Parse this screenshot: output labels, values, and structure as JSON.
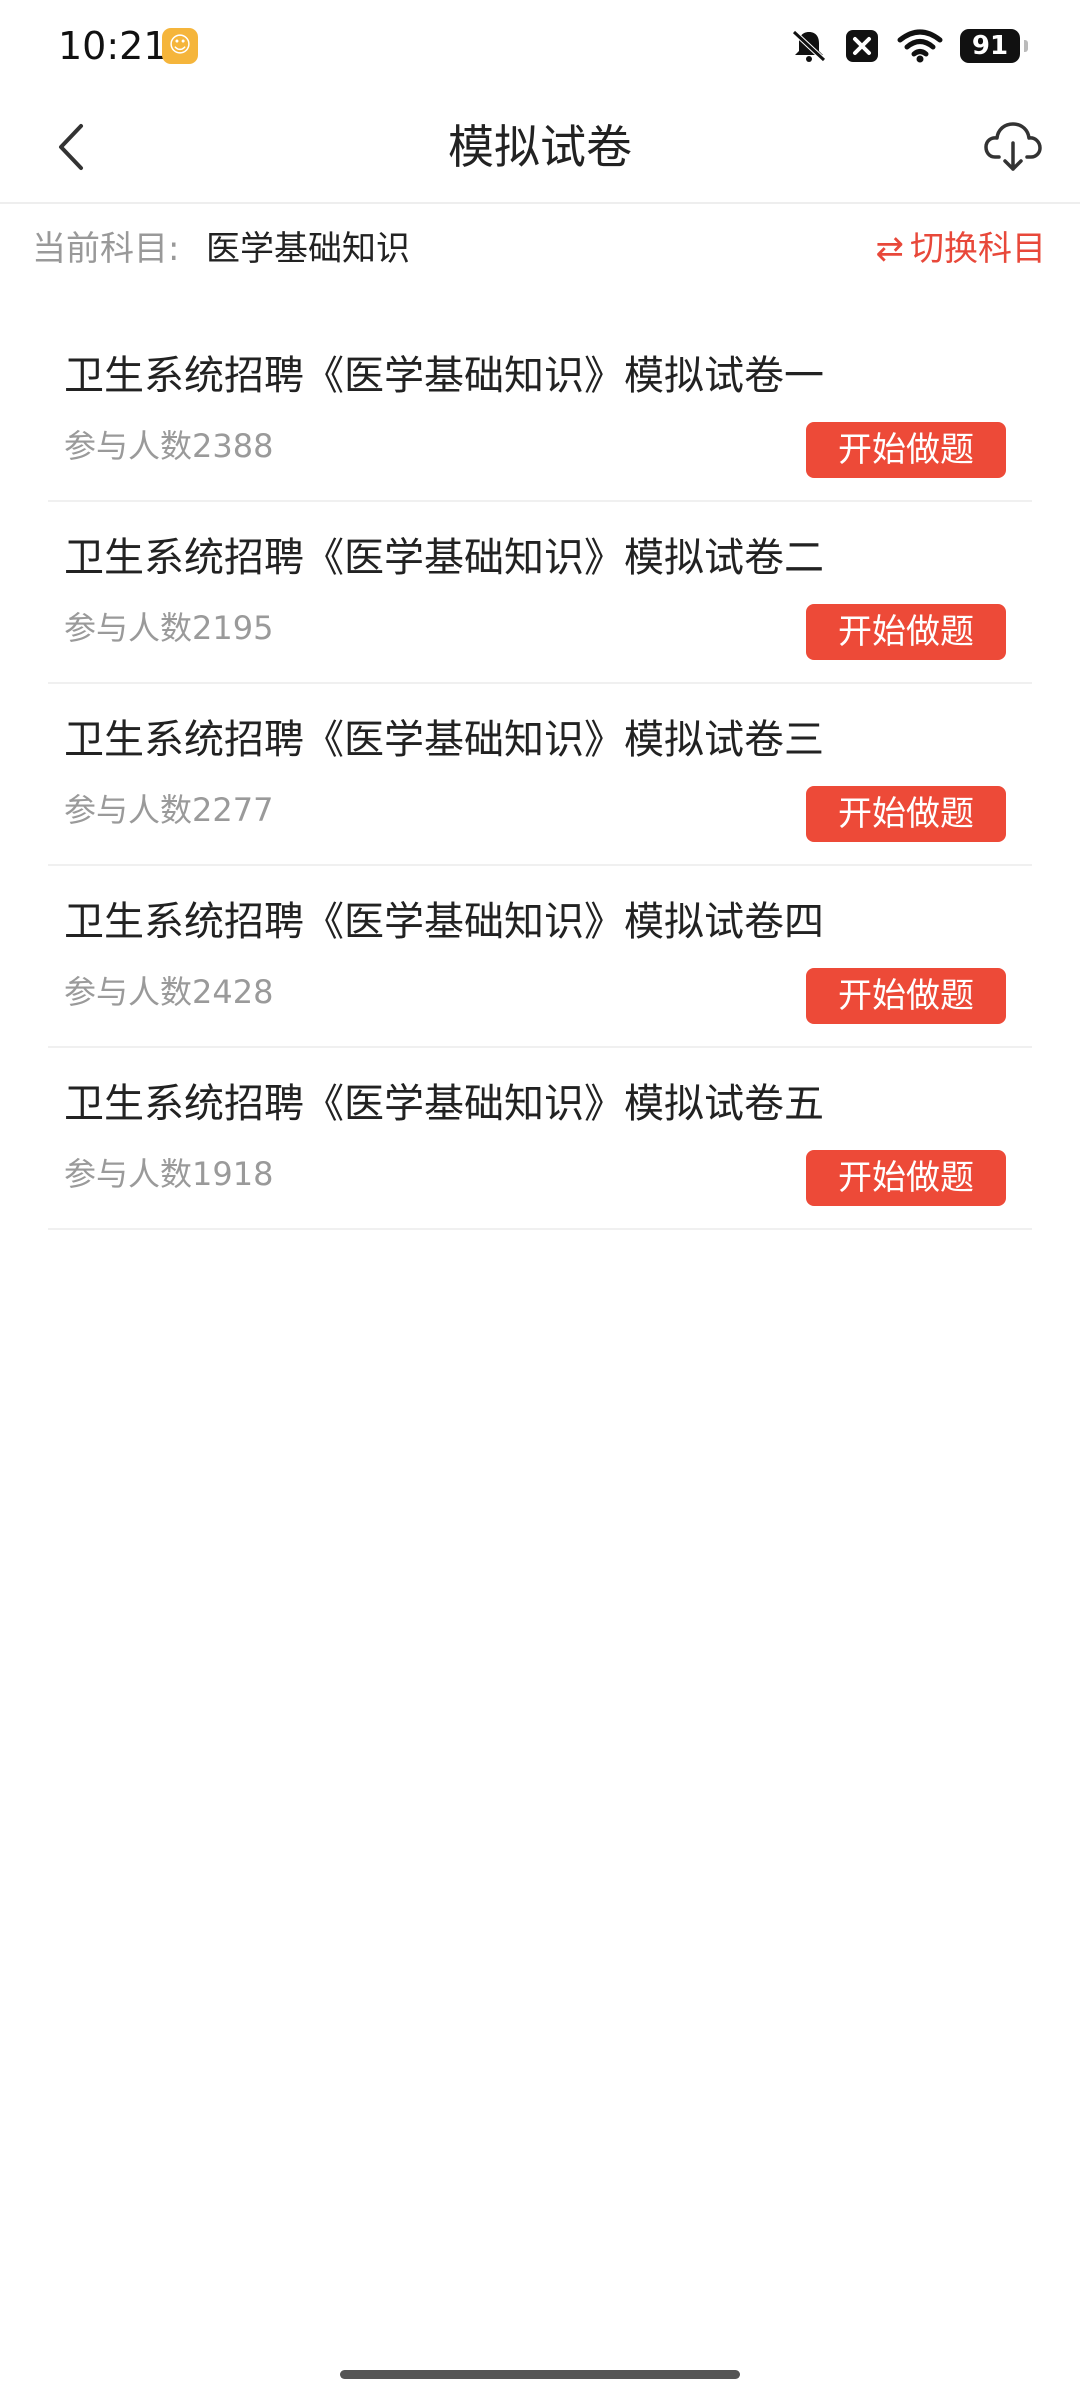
{
  "status_bar": {
    "time": "10:21",
    "app_icon": "app-notification-icon",
    "battery": "91",
    "icons": [
      "mute-icon",
      "close-notification-icon",
      "wifi-icon",
      "battery-icon"
    ]
  },
  "header": {
    "title": "模拟试卷",
    "back_icon": "chevron-left-icon",
    "download_icon": "cloud-download-icon"
  },
  "subject": {
    "label": "当前科目:",
    "value": "医学基础知识",
    "switch_label": "切换科目",
    "switch_icon": "swap-arrows-icon",
    "accent_color": "#e8483a"
  },
  "papers": [
    {
      "title": "卫生系统招聘《医学基础知识》模拟试卷一",
      "count": "参与人数2388",
      "button": "开始做题"
    },
    {
      "title": "卫生系统招聘《医学基础知识》模拟试卷二",
      "count": "参与人数2195",
      "button": "开始做题"
    },
    {
      "title": "卫生系统招聘《医学基础知识》模拟试卷三",
      "count": "参与人数2277",
      "button": "开始做题"
    },
    {
      "title": "卫生系统招聘《医学基础知识》模拟试卷四",
      "count": "参与人数2428",
      "button": "开始做题"
    },
    {
      "title": "卫生系统招聘《医学基础知识》模拟试卷五",
      "count": "参与人数1918",
      "button": "开始做题"
    }
  ],
  "colors": {
    "button_bg": "#ed4a38",
    "muted_text": "#9a9a9a"
  }
}
